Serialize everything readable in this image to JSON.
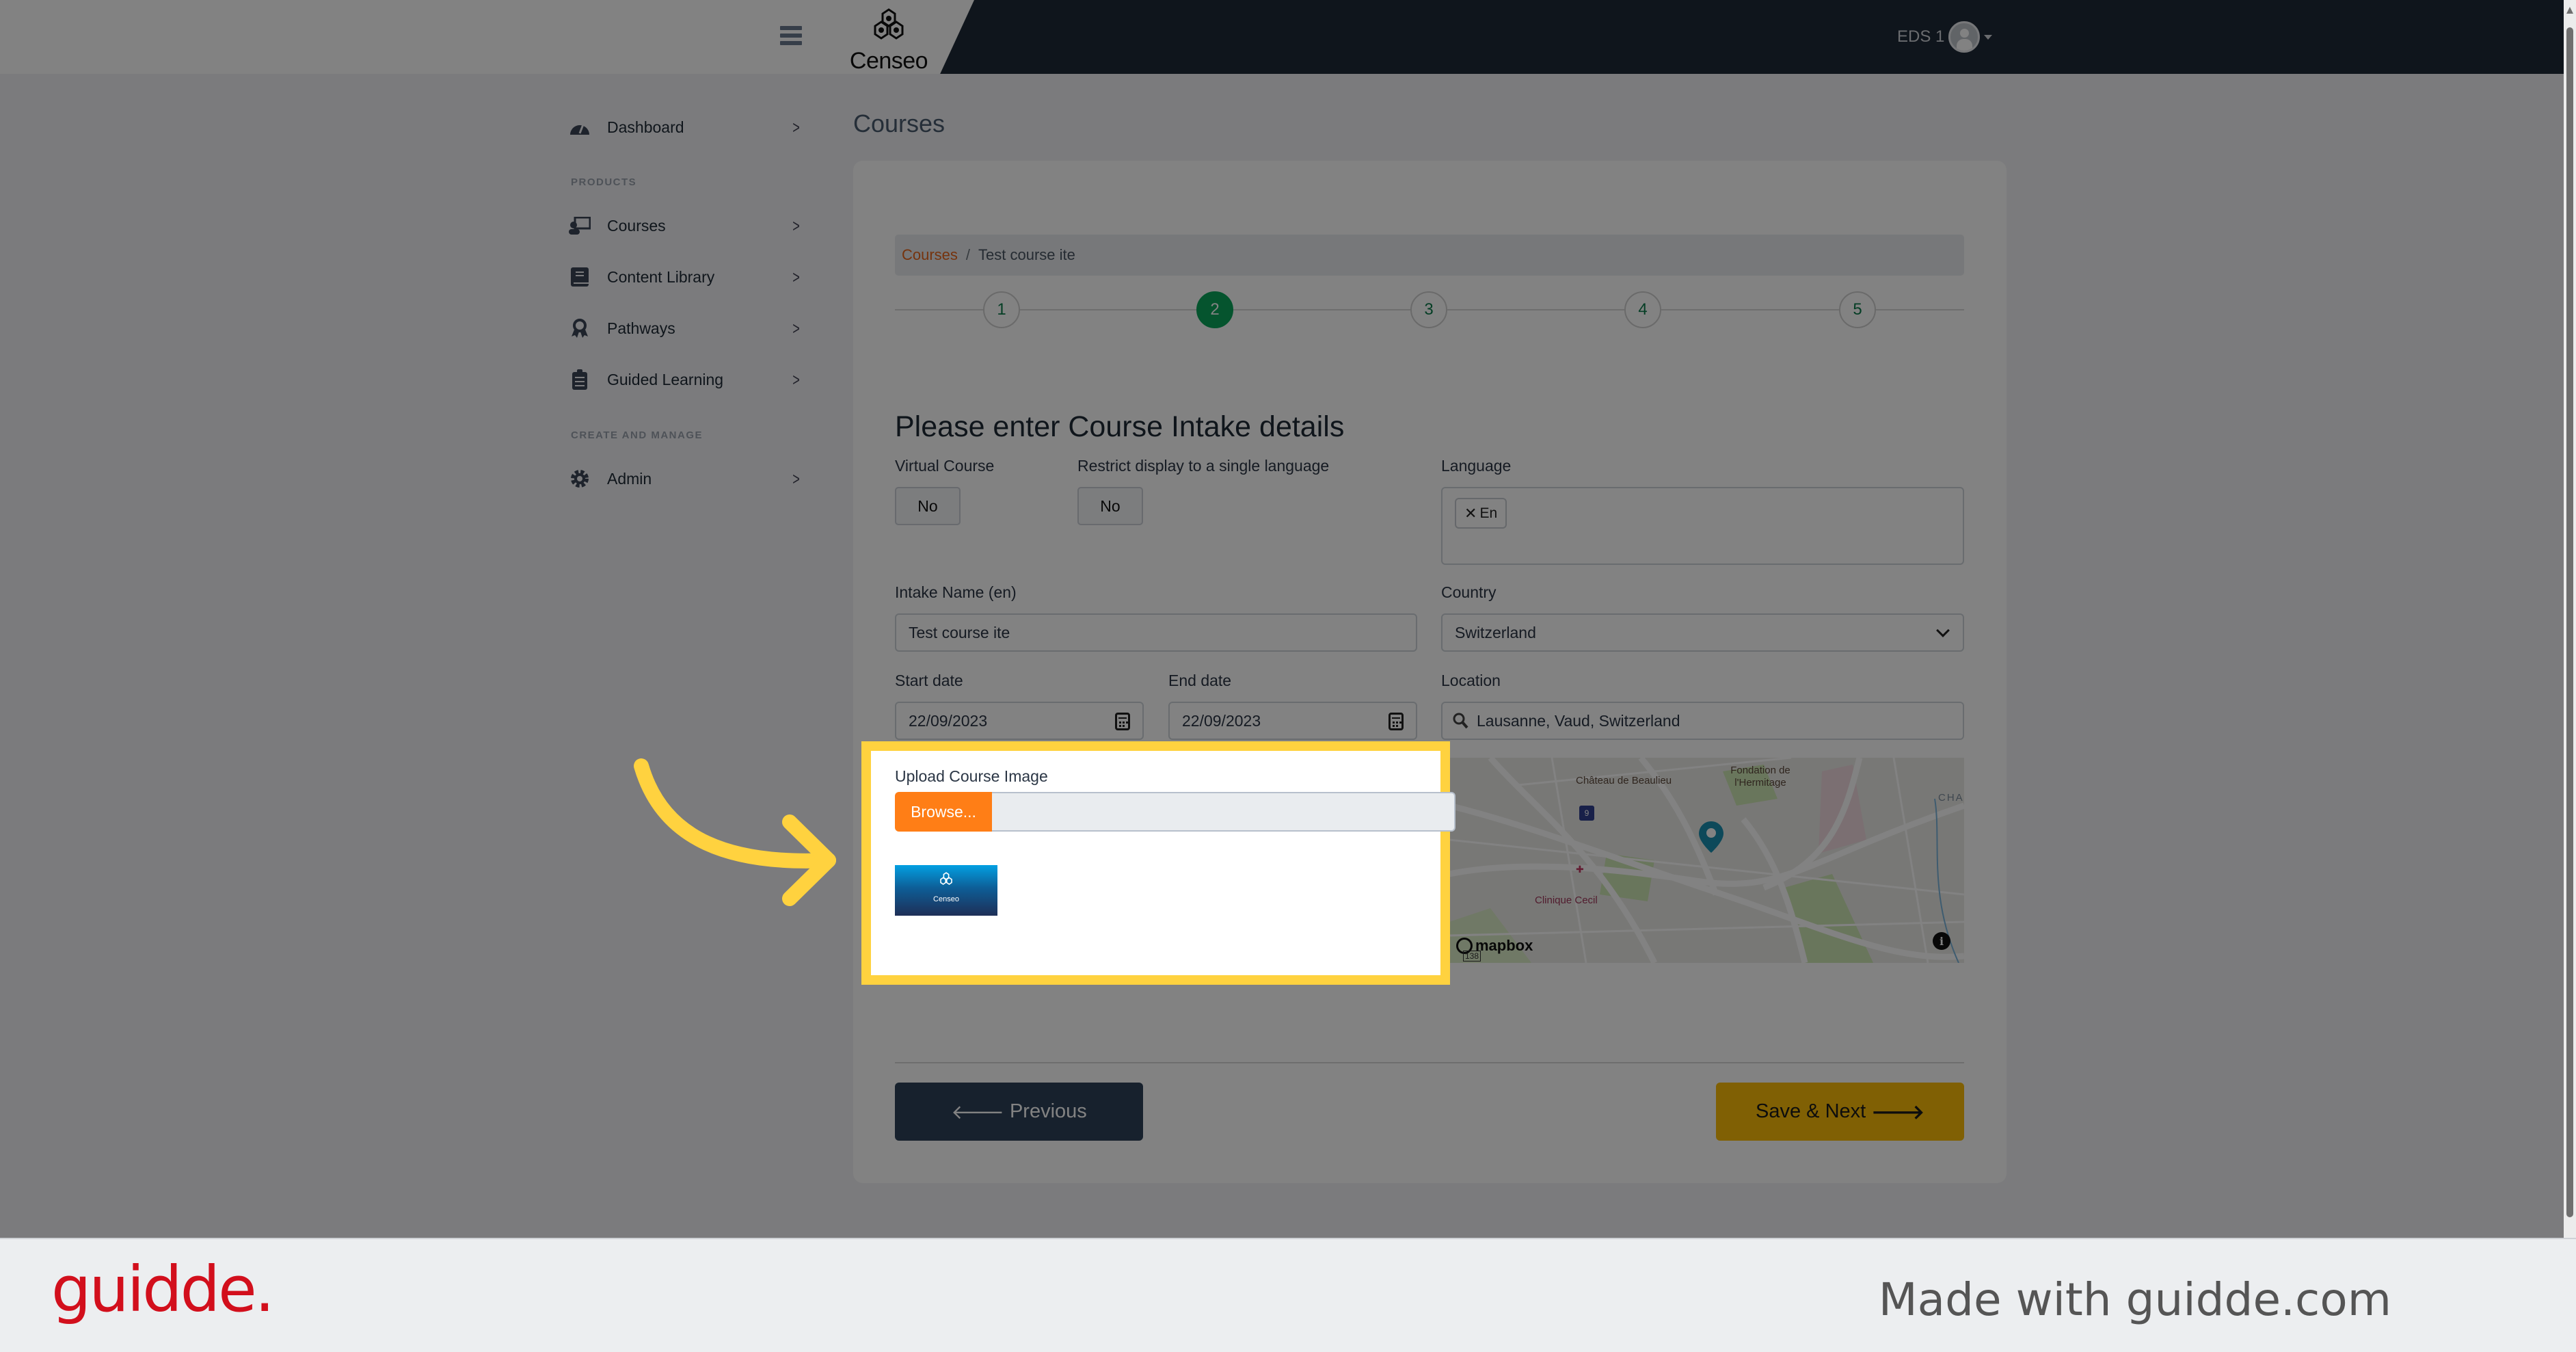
{
  "header": {
    "logo_text": "Censeo",
    "user_name": "EDS 1"
  },
  "sidebar": {
    "items": [
      {
        "label": "Dashboard",
        "icon": "dashboard-gauge-icon"
      },
      {
        "label": "Courses",
        "icon": "chalkboard-teacher-icon"
      },
      {
        "label": "Content Library",
        "icon": "book-icon"
      },
      {
        "label": "Pathways",
        "icon": "award-ribbon-icon"
      },
      {
        "label": "Guided Learning",
        "icon": "clipboard-list-icon"
      },
      {
        "label": "Admin",
        "icon": "gear-icon"
      }
    ],
    "section_products": "PRODUCTS",
    "section_manage": "CREATE AND MANAGE"
  },
  "page": {
    "title": "Courses",
    "breadcrumb": {
      "link": "Courses",
      "separator": "/",
      "current": "Test course ite"
    },
    "steps": [
      "1",
      "2",
      "3",
      "4",
      "5"
    ],
    "active_step": 2,
    "form_heading": "Please enter Course Intake details"
  },
  "form": {
    "virtual_course": {
      "label": "Virtual Course",
      "value": "No"
    },
    "restrict_language": {
      "label": "Restrict display to a single language",
      "value": "No"
    },
    "language": {
      "label": "Language",
      "chips": [
        "En"
      ]
    },
    "intake_name": {
      "label": "Intake Name (en)",
      "value": "Test course ite"
    },
    "country": {
      "label": "Country",
      "value": "Switzerland"
    },
    "start_date": {
      "label": "Start date",
      "value": "22/09/2023"
    },
    "end_date": {
      "label": "End date",
      "value": "22/09/2023"
    },
    "location": {
      "label": "Location",
      "value": "Lausanne, Vaud, Switzerland"
    },
    "upload_image": {
      "label": "Upload Course Image",
      "browse_label": "Browse...",
      "file_value": "",
      "preview_text": "Censeo"
    }
  },
  "map": {
    "labels": [
      "Château de Beaulieu",
      "Fondation de l'Hermitage",
      "Clinique Cecil",
      "CHA"
    ],
    "road_badges": [
      "9",
      "138"
    ],
    "attribution": "mapbox",
    "info_icon": "i"
  },
  "actions": {
    "previous_label": "Previous",
    "save_next_label": "Save & Next"
  },
  "colors": {
    "accent_orange": "#ff7e16",
    "active_step_green": "#0aa55a",
    "save_button": "#fbbd08",
    "previous_button": "#2e4258",
    "highlight": "#ffd23f",
    "guidde_red": "#d20f1c"
  },
  "footer": {
    "brand": "guidde.",
    "made_with": "Made with guidde.com"
  }
}
